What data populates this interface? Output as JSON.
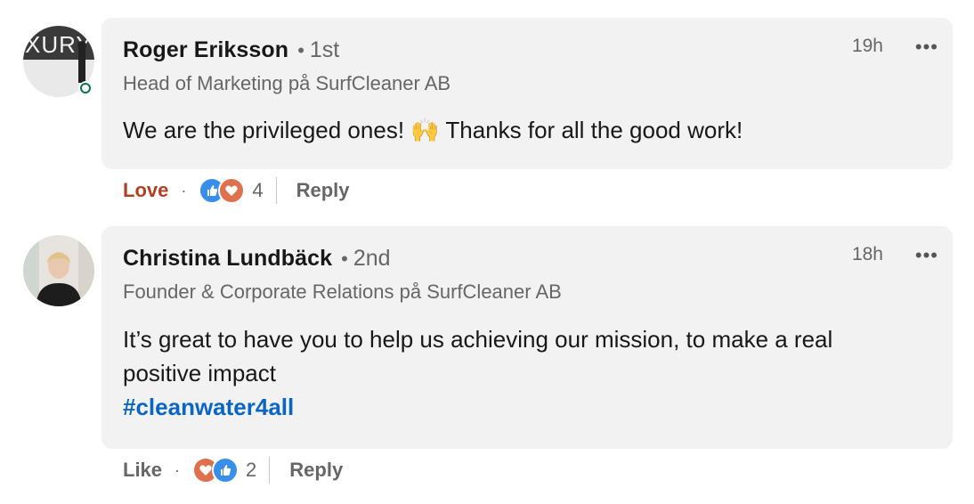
{
  "comments": [
    {
      "author": "Roger Eriksson",
      "separator": "•",
      "degree": "1st",
      "headline": "Head of Marketing på SurfCleaner AB",
      "time": "19h",
      "more": "•••",
      "text": "We are the privileged ones! 🙌 Thanks for all the good work!",
      "action_label": "Love",
      "dot": "·",
      "reaction_count": "4",
      "reply_label": "Reply",
      "avatar_text": "XURY",
      "online": true
    },
    {
      "author": "Christina Lundbäck",
      "separator": "•",
      "degree": "2nd",
      "headline": "Founder & Corporate Relations på SurfCleaner AB",
      "time": "18h",
      "more": "•••",
      "text_line1": "It’s great to have you to help us achieving our mission, to make a real",
      "text_line2": "positive impact",
      "hashtag": "#cleanwater4all",
      "action_label": "Like",
      "dot": "·",
      "reaction_count": "2",
      "reply_label": "Reply"
    }
  ],
  "colors": {
    "bubble": "#f2f2f2",
    "link": "#0a66c2",
    "love": "#b24020",
    "like_reaction": "#378fe9",
    "love_reaction": "#df704d",
    "online": "#057642"
  }
}
